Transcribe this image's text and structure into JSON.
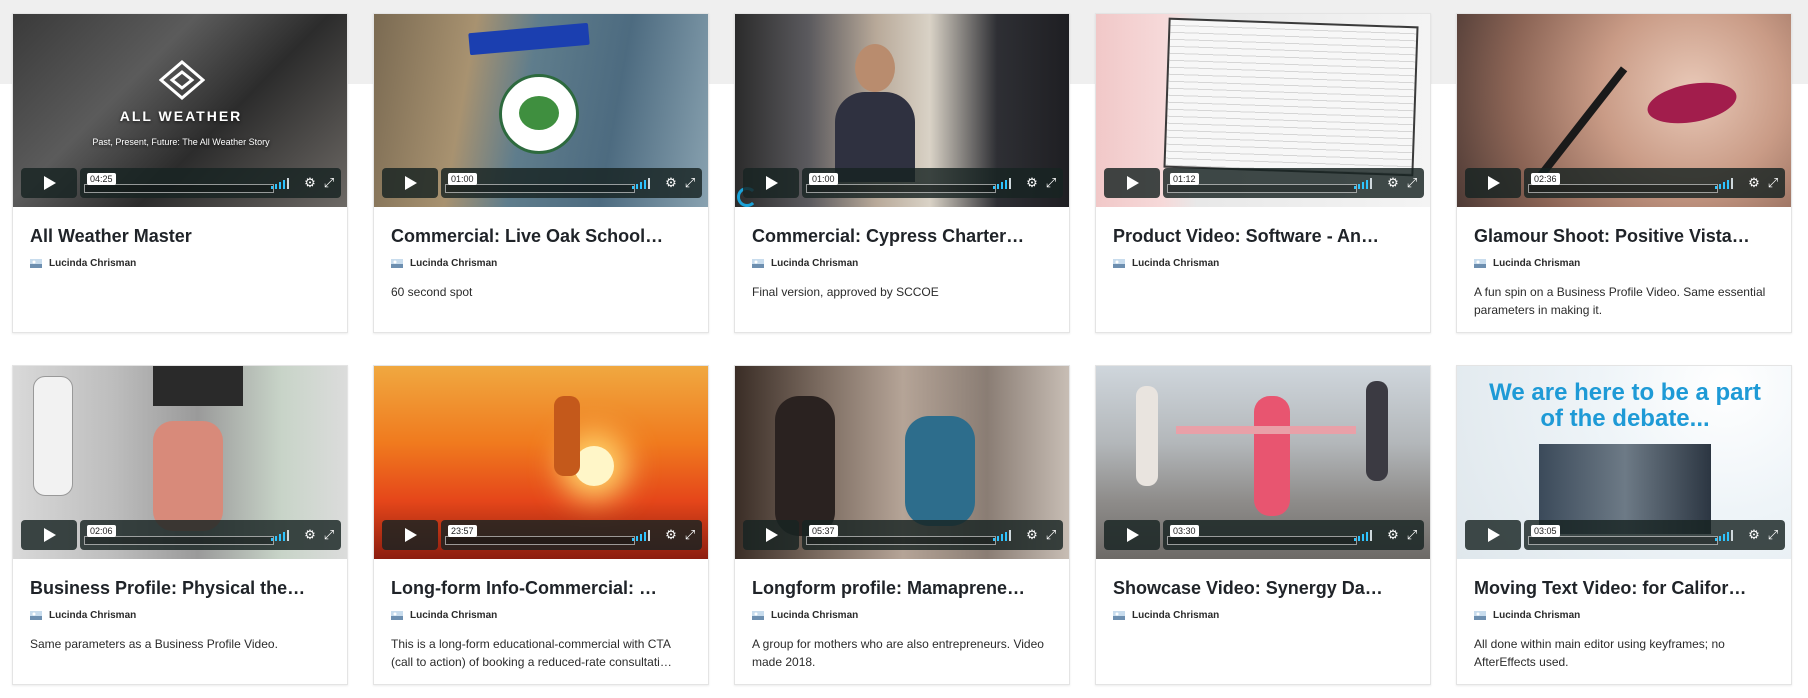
{
  "cards": [
    {
      "title": "All Weather Master",
      "author": "Lucinda Chrisman",
      "description": "",
      "duration": "04:25",
      "thumb_text": "ALL WEATHER",
      "thumb_sub": "Past, Present, Future: The All Weather Story"
    },
    {
      "title": "Commercial: Live Oak School…",
      "author": "Lucinda Chrisman",
      "description": "60 second spot",
      "duration": "01:00",
      "thumb_text": "",
      "thumb_sub": ""
    },
    {
      "title": "Commercial: Cypress Charter…",
      "author": "Lucinda Chrisman",
      "description": "Final version, approved by SCCOE",
      "duration": "01:00",
      "thumb_text": "",
      "thumb_sub": ""
    },
    {
      "title": "Product Video: Software - An…",
      "author": "Lucinda Chrisman",
      "description": "",
      "duration": "01:12",
      "thumb_text": "",
      "thumb_sub": ""
    },
    {
      "title": "Glamour Shoot: Positive Vista…",
      "author": "Lucinda Chrisman",
      "description": "A fun spin on a Business Profile Video. Same essential parameters in making it.",
      "duration": "02:36",
      "thumb_text": "",
      "thumb_sub": ""
    },
    {
      "title": "Business Profile: Physical the…",
      "author": "Lucinda Chrisman",
      "description": "Same parameters as a Business Profile Video.",
      "duration": "02:06",
      "thumb_text": "",
      "thumb_sub": ""
    },
    {
      "title": "Long-form Info-Commercial: …",
      "author": "Lucinda Chrisman",
      "description": "This is a long-form educational-commercial with CTA (call to action) of booking a reduced-rate consultati…",
      "duration": "23:57",
      "thumb_text": "",
      "thumb_sub": ""
    },
    {
      "title": "Longform profile: Mamaprene…",
      "author": "Lucinda Chrisman",
      "description": "A group for mothers who are also entrepreneurs. Video made 2018.",
      "duration": "05:37",
      "thumb_text": "",
      "thumb_sub": ""
    },
    {
      "title": "Showcase Video: Synergy Da…",
      "author": "Lucinda Chrisman",
      "description": "",
      "duration": "03:30",
      "thumb_text": "",
      "thumb_sub": ""
    },
    {
      "title": "Moving Text Video: for Califor…",
      "author": "Lucinda Chrisman",
      "description": "All done within main editor using keyframes; no AfterEffects used.",
      "duration": "03:05",
      "thumb_text": "We are here to be a part of the debate...",
      "thumb_sub": ""
    }
  ],
  "colors": {
    "player_bg": "#172322",
    "volume_accent": "#2ec4ff",
    "title_text": "#1f2328",
    "page_band": "#efefef"
  },
  "icons": {
    "play": "play-icon",
    "volume": "volume-icon",
    "settings": "gear-icon",
    "fullscreen": "fullscreen-icon",
    "avatar": "author-avatar-icon"
  }
}
